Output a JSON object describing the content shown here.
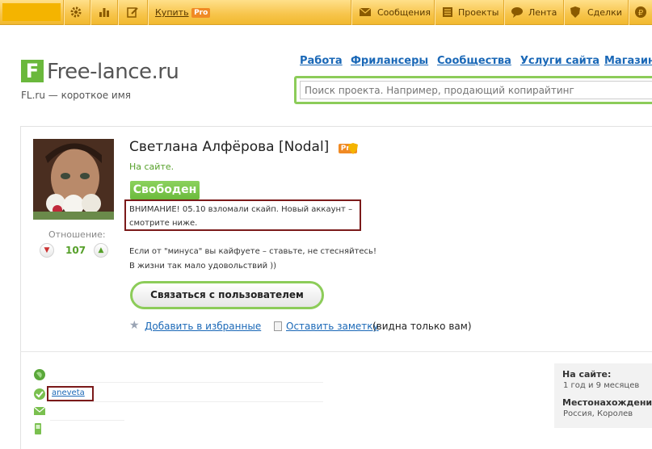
{
  "topbar": {
    "buy_label": "Купить",
    "pro_badge": "Pro",
    "messages": "Сообщения",
    "projects": "Проекты",
    "feed": "Лента",
    "deals": "Сделки"
  },
  "header": {
    "logo_letter": "F",
    "logo_name": "Free-lance.ru",
    "subtitle": "FL.ru — короткое имя",
    "nav": [
      "Работа",
      "Фрилансеры",
      "Сообщества",
      "Услуги сайта",
      "Магазин"
    ],
    "search_placeholder": "Поиск проекта. Например, продающий копирайтинг"
  },
  "profile": {
    "name": "Светлана Алфёрова [Nodal]",
    "pro_badge": "Pro",
    "online_status": "На сайте.",
    "free_badge": "Свободен",
    "rating_label": "Отношение:",
    "rating_value": "107",
    "warning_line1": "ВНИМАНИЕ! 05.10 взломали скайп. Новый аккаунт –",
    "warning_line2": "смотрите ниже.",
    "about_line1": "Если от \"минуса\" вы кайфуете – ставьте, не стесняйтесь!",
    "about_line2": "В жизни так мало удовольствий ))",
    "contact_button": "Связаться с пользователем",
    "favorite_link": "Добавить в избранные",
    "note_link": "Оставить заметку",
    "note_hint": "(видна только вам)"
  },
  "contacts": {
    "skype": "aneveta"
  },
  "sidebar": {
    "on_site_title": "На сайте:",
    "on_site_value": "1 год и 9 месяцев",
    "location_title": "Местонахождение:",
    "location_value": "Россия, Королев"
  },
  "colors": {
    "topbar": "#f7c44a",
    "accent_green": "#6ab83c",
    "link_blue": "#1a68b7",
    "pro_orange": "#f08a24",
    "highlight_box": "#7b1a1a"
  }
}
